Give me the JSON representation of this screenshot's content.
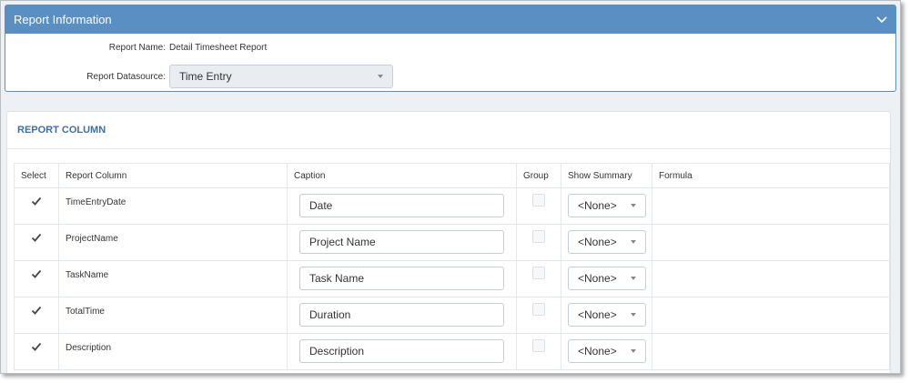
{
  "report_information": {
    "title": "Report Information",
    "report_name_label": "Report Name:",
    "report_name_value": "Detail Timesheet Report",
    "datasource_label": "Report Datasource:",
    "datasource_value": "Time Entry"
  },
  "report_column": {
    "title": "REPORT COLUMN",
    "headers": {
      "select": "Select",
      "report_column": "Report Column",
      "caption": "Caption",
      "group": "Group",
      "show_summary": "Show Summary",
      "formula": "Formula"
    },
    "rows": [
      {
        "selected": true,
        "column": "TimeEntryDate",
        "caption": "Date",
        "group": false,
        "summary": "<None>",
        "formula": ""
      },
      {
        "selected": true,
        "column": "ProjectName",
        "caption": "Project Name",
        "group": false,
        "summary": "<None>",
        "formula": ""
      },
      {
        "selected": true,
        "column": "TaskName",
        "caption": "Task Name",
        "group": false,
        "summary": "<None>",
        "formula": ""
      },
      {
        "selected": true,
        "column": "TotalTime",
        "caption": "Duration",
        "group": false,
        "summary": "<None>",
        "formula": ""
      },
      {
        "selected": true,
        "column": "Description",
        "caption": "Description",
        "group": false,
        "summary": "<None>",
        "formula": ""
      }
    ]
  },
  "colors": {
    "header_bg": "#5a8fc3",
    "section_title": "#3f6fa5"
  },
  "icons": {
    "collapse": "chevron-down-icon",
    "checkbox": "check-icon",
    "dropdown": "caret-down-icon"
  }
}
